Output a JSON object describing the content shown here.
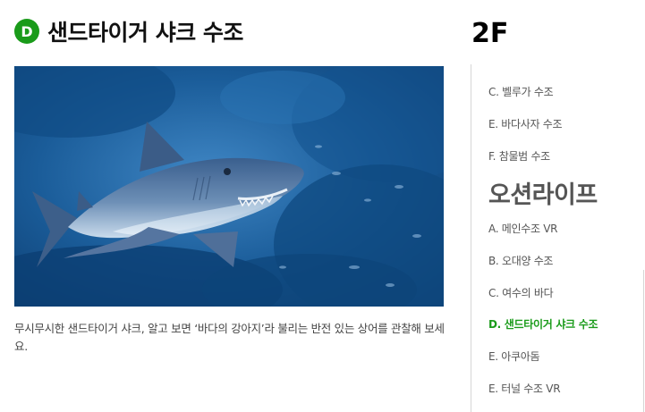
{
  "header": {
    "badge": "D",
    "title": "샌드타이거 샤크 수조"
  },
  "photo": {
    "subject": "shark-photo"
  },
  "caption": "무시무시한 샌드타이거 샤크, 알고 보면 ‘바다의 강아지’라 불리는 반전 있는 상어를 관찰해 보세요.",
  "sidebar": {
    "floor": "2F",
    "items_top": [
      {
        "label": "C. 벨루가 수조"
      },
      {
        "label": "E. 바다사자 수조"
      },
      {
        "label": "F. 참물범 수조"
      }
    ],
    "section": "오션라이프",
    "items_section": [
      {
        "label": "A. 메인수조 VR"
      },
      {
        "label": "B. 오대양 수조"
      },
      {
        "label": "C. 여수의 바다"
      },
      {
        "label": "D. 샌드타이거 샤크 수조",
        "active": true
      },
      {
        "label": "E. 아쿠아돔"
      },
      {
        "label": "E. 터널 수조 VR"
      }
    ]
  },
  "colors": {
    "accent": "#1a9b1a",
    "text": "#111111",
    "muted": "#555555"
  }
}
